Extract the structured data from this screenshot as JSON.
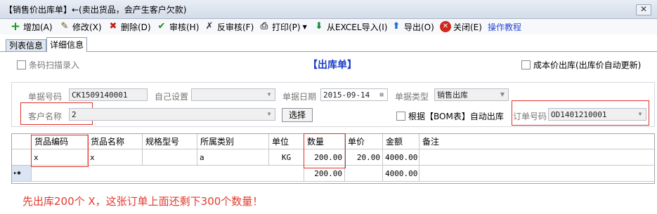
{
  "window": {
    "title": "【销售价出库单】←(卖出货品，会产生客户欠款)",
    "close_glyph": "✕"
  },
  "toolbar": {
    "add": "增加(A)",
    "edit": "修改(X)",
    "delete": "删除(D)",
    "audit": "审核(H)",
    "unaudit": "反审核(F)",
    "print": "打印(P)",
    "import_excel": "从EXCEL导入(I)",
    "export": "导出(O)",
    "close": "关闭(E)",
    "tutorial": "操作教程"
  },
  "tabs": {
    "list": "列表信息",
    "detail": "详细信息"
  },
  "options": {
    "barcode_scan": "条码扫描录入",
    "cost_outbound": "成本价出库(出库价自动更新)"
  },
  "form": {
    "heading": "【出库单】",
    "doc_no_label": "单据号码",
    "doc_no": "CK1509140001",
    "custom_label": "自己设置",
    "doc_date_label": "单据日期",
    "doc_date": "2015-09-14",
    "doc_type_label": "单据类型",
    "doc_type": "销售出库",
    "customer_label": "客户名称",
    "customer": "2",
    "select_button": "选择",
    "bom_auto": "根据【BOM表】自动出库",
    "order_no_label": "订单号码",
    "order_no": "OD1401210001"
  },
  "grid": {
    "columns": [
      "货品编码",
      "货品名称",
      "规格型号",
      "所属类别",
      "单位",
      "数量",
      "单价",
      "金额",
      "备注"
    ],
    "rows": [
      {
        "code": "x",
        "name": "x",
        "spec": "",
        "category": "a",
        "unit": "KG",
        "qty": "200.00",
        "price": "20.00",
        "amount": "4000.00",
        "remark": ""
      }
    ],
    "new_row": {
      "marker": "▸✱",
      "qty": "200.00",
      "amount": "4000.00"
    }
  },
  "annotation": "先出库200个 X，这张订单上面还剩下300个数量！",
  "colors": {
    "annotation_red": "#e33a2c",
    "highlight_box": "#e0302a",
    "heading_blue": "#1a3fc7"
  }
}
